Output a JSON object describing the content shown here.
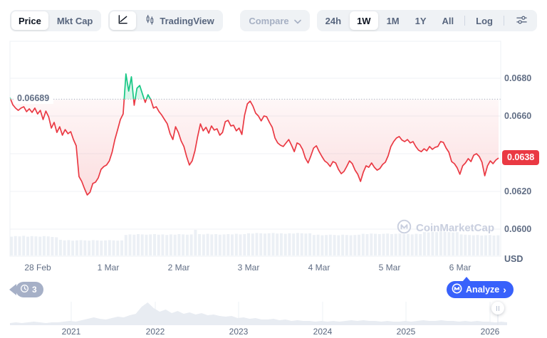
{
  "toolbar": {
    "metric_tabs": [
      {
        "label": "Price",
        "active": true
      },
      {
        "label": "Mkt Cap",
        "active": false
      }
    ],
    "tradingview_label": "TradingView",
    "compare_label": "Compare",
    "range_tabs": [
      {
        "label": "24h",
        "active": false
      },
      {
        "label": "1W",
        "active": true
      },
      {
        "label": "1M",
        "active": false
      },
      {
        "label": "1Y",
        "active": false
      },
      {
        "label": "All",
        "active": false
      }
    ],
    "log_label": "Log"
  },
  "chart": {
    "basis_label": "0.06689",
    "current_price_label": "0.0638",
    "unit_label": "USD",
    "watermark": "CoinMarketCap"
  },
  "footer": {
    "history_count": "3",
    "analyze_label": "Analyze"
  },
  "icons": {
    "chevron_right": "›"
  },
  "colors": {
    "accent_blue": "#3861fb",
    "up_green": "#16c784",
    "down_red": "#ea3943",
    "badge_gray": "#a6b0c7",
    "grid_line": "#eff2f5",
    "volume_bar": "#ecf0f5",
    "nav_area": "#e8ecf2",
    "label_text": "#616e85"
  },
  "chart_data": {
    "type": "line",
    "title": "Price (1W)",
    "unit": "USD",
    "basis_price": 0.06689,
    "current_price": 0.0638,
    "ylim": [
      0.0586,
      0.07
    ],
    "grid": true,
    "legend_position": "none",
    "y_ticks": [
      0.068,
      0.066,
      0.064,
      0.062,
      0.06
    ],
    "y_tick_labels": [
      {
        "label": "0.0680",
        "value": 0.068
      },
      {
        "label": "0.0660",
        "value": 0.066
      },
      {
        "label": "0.0620",
        "value": 0.062
      },
      {
        "label": "0.0600",
        "value": 0.06
      }
    ],
    "x_ticks": [
      "28 Feb",
      "1 Mar",
      "2 Mar",
      "3 Mar",
      "4 Mar",
      "5 Mar",
      "6 Mar"
    ],
    "prices": [
      0.06698,
      0.0666,
      0.06642,
      0.0663,
      0.06642,
      0.06649,
      0.06623,
      0.06638,
      0.06619,
      0.06642,
      0.06611,
      0.0663,
      0.06581,
      0.06626,
      0.06596,
      0.06536,
      0.06566,
      0.06513,
      0.06543,
      0.06498,
      0.06528,
      0.06506,
      0.06517,
      0.06475,
      0.06442,
      0.06279,
      0.06253,
      0.06215,
      0.06181,
      0.06196,
      0.06242,
      0.06249,
      0.06272,
      0.06317,
      0.06332,
      0.0634,
      0.06362,
      0.06408,
      0.06475,
      0.06528,
      0.06581,
      0.06611,
      0.06823,
      0.06732,
      0.06808,
      0.06657,
      0.06747,
      0.06762,
      0.06717,
      0.06672,
      0.06713,
      0.06687,
      0.06642,
      0.06649,
      0.06623,
      0.06604,
      0.06581,
      0.06558,
      0.06506,
      0.06475,
      0.06543,
      0.06513,
      0.06468,
      0.06438,
      0.06385,
      0.0634,
      0.06362,
      0.06415,
      0.06491,
      0.06558,
      0.06521,
      0.0654,
      0.06509,
      0.06547,
      0.06525,
      0.06532,
      0.06498,
      0.06513,
      0.0657,
      0.06577,
      0.06547,
      0.06551,
      0.06521,
      0.06536,
      0.06502,
      0.06604,
      0.06664,
      0.06679,
      0.06653,
      0.06615,
      0.066,
      0.06574,
      0.066,
      0.06596,
      0.06566,
      0.0654,
      0.06483,
      0.06457,
      0.06445,
      0.06438,
      0.06457,
      0.06475,
      0.06445,
      0.06411,
      0.06457,
      0.06449,
      0.06423,
      0.06377,
      0.06351,
      0.06389,
      0.0643,
      0.06442,
      0.06411,
      0.06385,
      0.06362,
      0.06351,
      0.06332,
      0.06358,
      0.06351,
      0.06317,
      0.06294,
      0.06306,
      0.06332,
      0.06362,
      0.06347,
      0.06313,
      0.06291,
      0.06253,
      0.06302,
      0.06336,
      0.06328,
      0.06351,
      0.06328,
      0.06313,
      0.06321,
      0.06343,
      0.06355,
      0.06389,
      0.06438,
      0.06464,
      0.06483,
      0.06491,
      0.06472,
      0.06464,
      0.06475,
      0.06457,
      0.06464,
      0.06438,
      0.06419,
      0.06411,
      0.06426,
      0.06415,
      0.06438,
      0.06423,
      0.06434,
      0.06438,
      0.06464,
      0.0646,
      0.0643,
      0.06408,
      0.06358,
      0.06347,
      0.06325,
      0.06291,
      0.06336,
      0.06351,
      0.06374,
      0.06358,
      0.06392,
      0.064,
      0.06385,
      0.06355,
      0.06283,
      0.06336,
      0.06362,
      0.06347,
      0.06366,
      0.06377
    ],
    "volume_profile": [
      0.66,
      0.68,
      0.67,
      0.69,
      0.66,
      0.68,
      0.67,
      0.66,
      0.68,
      0.67,
      0.65,
      0.64,
      0.55,
      0.53,
      0.54,
      0.52,
      0.53,
      0.54,
      0.53,
      0.52,
      0.54,
      0.53,
      0.52,
      0.53,
      0.54,
      0.53,
      0.52,
      0.53,
      0.72,
      0.74,
      0.73,
      0.75,
      0.74,
      0.73,
      0.74,
      0.75,
      0.73,
      0.74,
      0.72,
      0.74,
      0.73,
      0.75,
      0.74,
      0.73,
      0.74,
      0.9,
      0.75,
      0.74,
      0.76,
      0.74,
      0.75,
      0.73,
      0.74,
      0.75,
      0.74,
      0.76,
      0.74,
      0.75,
      0.78,
      0.77,
      0.79,
      0.78,
      0.77,
      0.78,
      0.79,
      0.77,
      0.78,
      0.76,
      0.78,
      0.77,
      0.79,
      0.78,
      0.77,
      0.78,
      0.72,
      0.73,
      0.71,
      0.72,
      0.73,
      0.72,
      0.71,
      0.73,
      0.72,
      0.71,
      0.72,
      0.73,
      0.76,
      0.75,
      0.77,
      0.76,
      0.75,
      0.76,
      0.77,
      0.75,
      0.76,
      0.77,
      0.75,
      0.76,
      0.74,
      0.76,
      0.75,
      0.82,
      0.81,
      0.83,
      0.82,
      0.84,
      0.83,
      0.82,
      0.81,
      0.82,
      0.74,
      0.73,
      0.72,
      0.71,
      0.72,
      0.7,
      0.71,
      0.72,
      0.7,
      0.71
    ],
    "navigator": {
      "year_labels": [
        "2021",
        "2022",
        "2023",
        "2024",
        "2025",
        "2026"
      ],
      "profile": [
        3,
        4,
        3,
        4,
        5,
        4,
        3,
        4,
        4,
        5,
        6,
        5,
        7,
        9,
        11,
        9,
        8,
        10,
        12,
        11,
        14,
        16,
        26,
        32,
        24,
        19,
        22,
        17,
        20,
        16,
        18,
        15,
        17,
        14,
        15,
        13,
        12,
        13,
        10,
        11,
        9,
        10,
        8,
        8,
        9,
        7,
        8,
        6,
        7,
        6,
        6,
        5,
        6,
        5,
        6,
        5,
        6,
        7,
        6,
        7,
        6,
        6,
        5,
        6,
        5,
        5,
        6,
        5,
        6,
        7,
        6,
        6,
        7,
        6,
        6,
        5,
        6,
        5,
        6,
        5,
        5,
        4,
        5,
        4
      ]
    }
  }
}
